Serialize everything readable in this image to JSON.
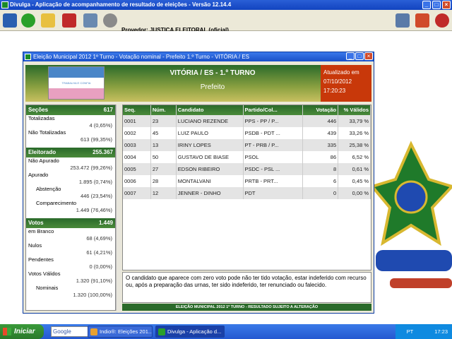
{
  "app": {
    "title": "Divulga - Aplicação de acompanhamento de resultado de eleições - Versão 12.14.4"
  },
  "toolbar": {
    "provider": "Provedor: JUSTIÇA ELEITORAL (oficial)"
  },
  "window": {
    "title": "Eleição Municipal 2012 1º Turno - Votação nominal - Prefeito 1.º Turno - VITÓRIA / ES"
  },
  "header": {
    "flag_text": "TRABALHA E CONFIA",
    "city": "VITÓRIA / ES - 1.º TURNO",
    "office": "Prefeito",
    "updated_label": "Atualizado em",
    "updated_date": "07/10/2012",
    "updated_time": "17:20:23"
  },
  "sidebar": {
    "secoes": {
      "label": "Seções",
      "value": "617"
    },
    "totalizadas": {
      "label": "Totalizadas",
      "value": "4 (0,65%)"
    },
    "nao_totalizadas": {
      "label": "Não Totalizadas",
      "value": "613 (99,35%)"
    },
    "eleitorado": {
      "label": "Eleitorado",
      "value": "255.367"
    },
    "nao_apurado": {
      "label": "Não Apurado",
      "value": "253.472 (99,26%)"
    },
    "apurado": {
      "label": "Apurado",
      "value": "1.895 (0,74%)"
    },
    "abstencao": {
      "label": "Abstenção",
      "value": "446 (23,54%)"
    },
    "comparecimento": {
      "label": "Comparecimento",
      "value": "1.449 (76,46%)"
    },
    "votos": {
      "label": "Votos",
      "value": "1.449"
    },
    "em_branco": {
      "label": "em Branco",
      "value": "68 (4,69%)"
    },
    "nulos": {
      "label": "Nulos",
      "value": "61 (4,21%)"
    },
    "pendentes": {
      "label": "Pendentes",
      "value": "0 (0,00%)"
    },
    "votos_validos": {
      "label": "Votos Válidos",
      "value": "1.320 (91,10%)"
    },
    "nominais": {
      "label": "Nominais",
      "value": "1.320 (100,00%)"
    }
  },
  "table": {
    "headers": [
      "Seq.",
      "Núm.",
      "Candidato",
      "Partido/Col...",
      "Votação",
      "% Válidos"
    ],
    "rows": [
      [
        "0001",
        "23",
        "LUCIANO REZENDE",
        "PPS - PP / P...",
        "446",
        "33,79 %"
      ],
      [
        "0002",
        "45",
        "LUIZ PAULO",
        "PSDB - PDT ...",
        "439",
        "33,26 %"
      ],
      [
        "0003",
        "13",
        "IRINY LOPES",
        "PT - PRB / P...",
        "335",
        "25,38 %"
      ],
      [
        "0004",
        "50",
        "GUSTAVO DE BIASE",
        "PSOL",
        "86",
        "6,52 %"
      ],
      [
        "0005",
        "27",
        "EDSON RIBEIRO",
        "PSDC - PSL ...",
        "8",
        "0,61 %"
      ],
      [
        "0006",
        "28",
        "MONTALVANI",
        "PRTB - PRT...",
        "6",
        "0,45 %"
      ],
      [
        "0007",
        "12",
        "JENNER - DINHO",
        "PDT",
        "0",
        "0,00 %"
      ]
    ]
  },
  "notice": "O candidato que aparece com zero voto pode não ter tido votação, estar indeferido com recurso ou, após a preparação das urnas, ter sido indeferido, ter renunciado ou falecido.",
  "footer": "ELEIÇÃO MUNICIPAL 2012 1º TURNO - RESULTADO SUJEITO A ALTERAÇÃO",
  "taskbar": {
    "start": "Iniciar",
    "google": "Google",
    "task1": "Indio®: Eleições 201...",
    "task2": "Divulga - Aplicação d...",
    "lang": "PT",
    "clock": "17:23"
  }
}
